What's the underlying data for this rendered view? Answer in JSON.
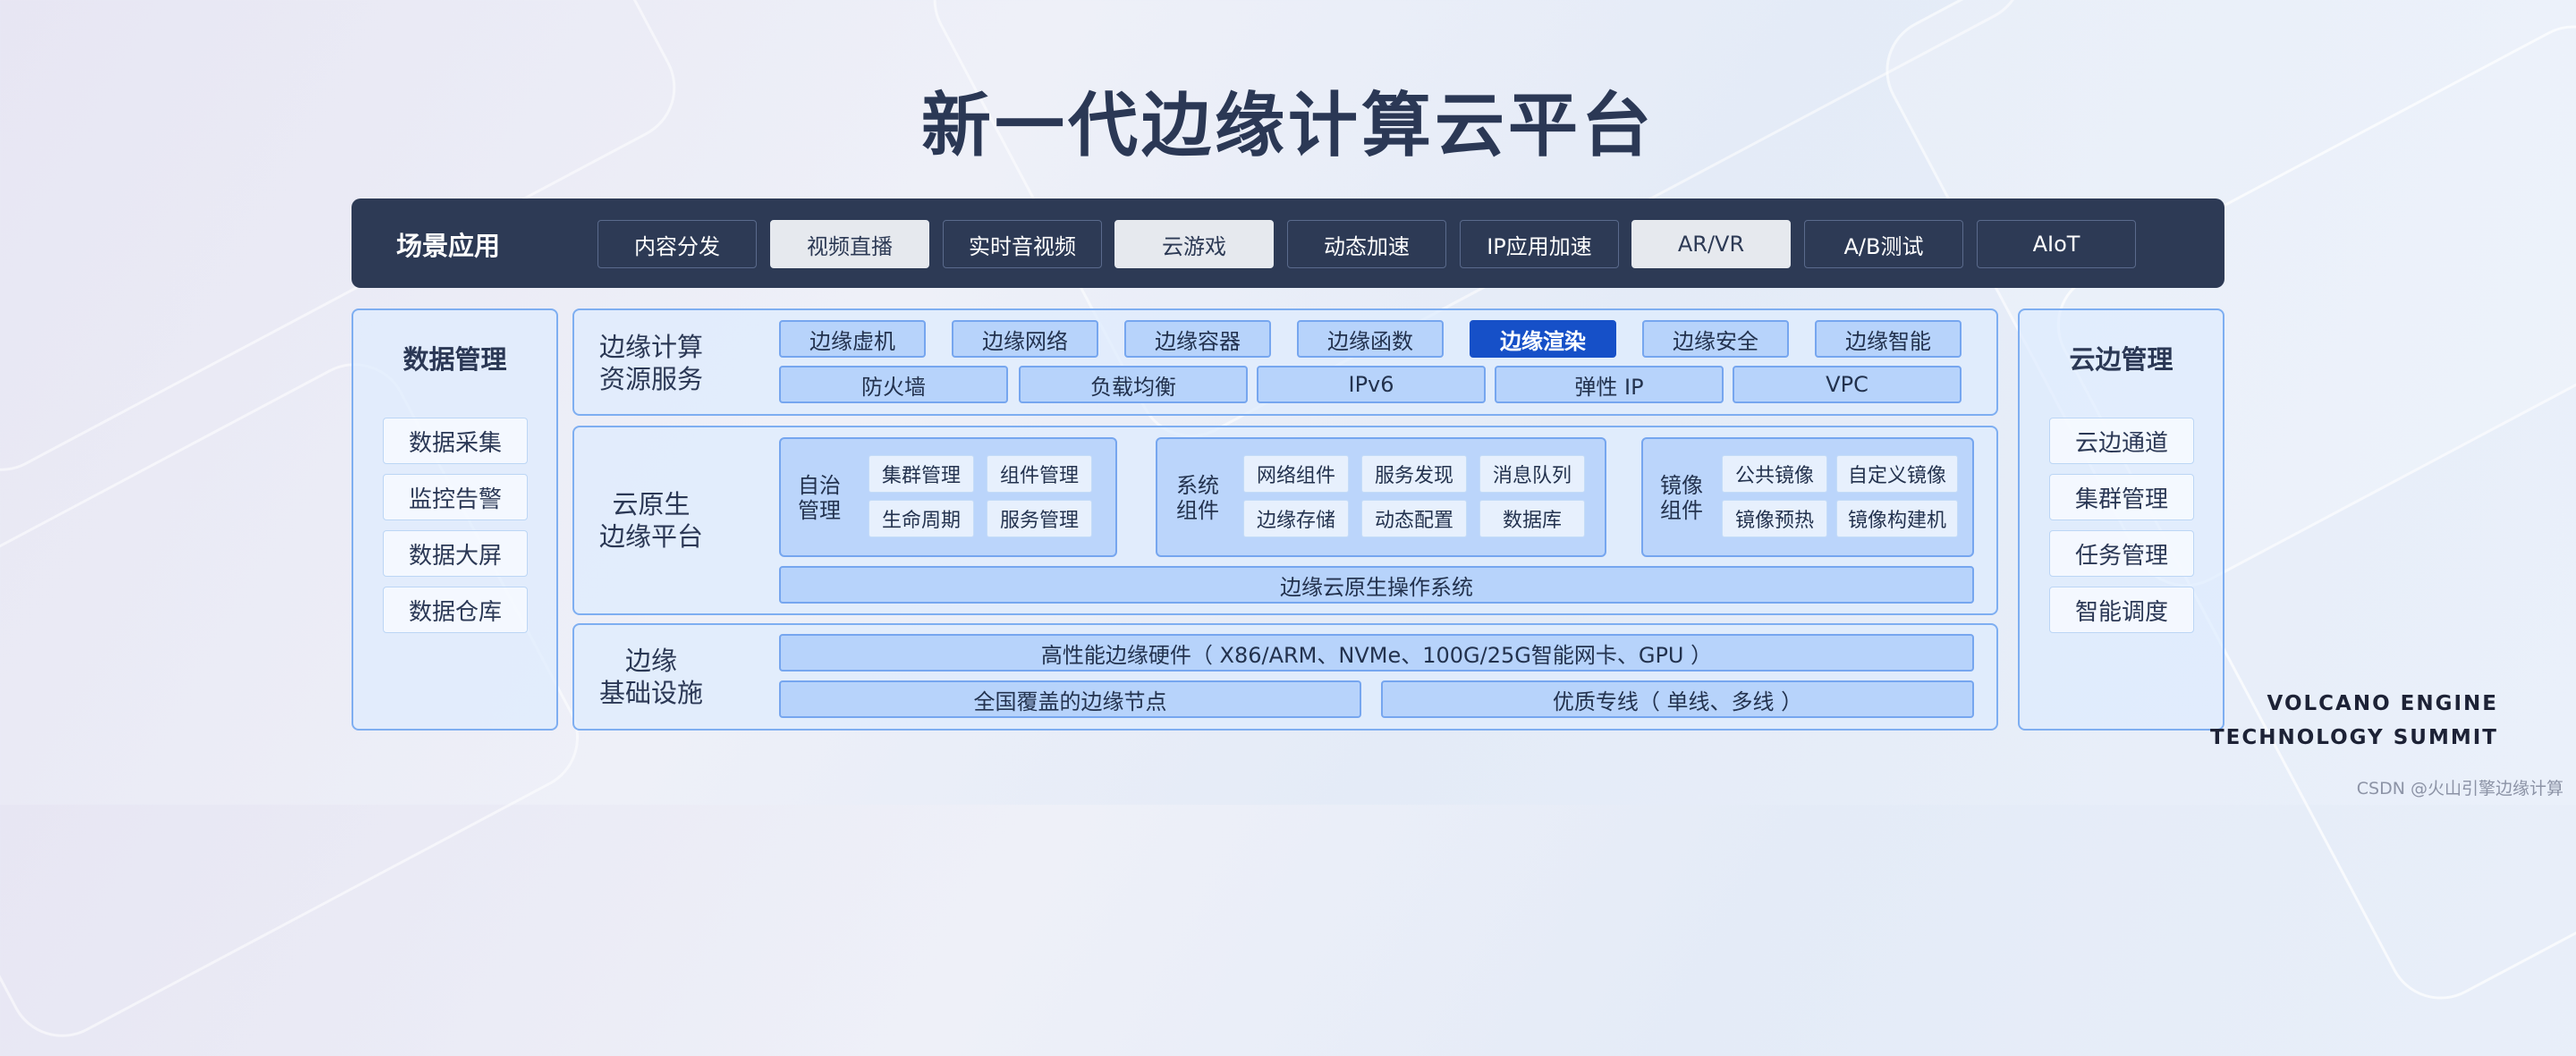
{
  "title": "新一代边缘计算云平台",
  "scenario": {
    "label": "场景应用",
    "items": [
      {
        "label": "内容分发",
        "light": false
      },
      {
        "label": "视频直播",
        "light": true
      },
      {
        "label": "实时音视频",
        "light": false
      },
      {
        "label": "云游戏",
        "light": true
      },
      {
        "label": "动态加速",
        "light": false
      },
      {
        "label": "IP应用加速",
        "light": false
      },
      {
        "label": "AR/VR",
        "light": true
      },
      {
        "label": "A/B测试",
        "light": false
      },
      {
        "label": "AIoT",
        "light": false
      }
    ]
  },
  "left_panel": {
    "title": "数据管理",
    "items": [
      "数据采集",
      "监控告警",
      "数据大屏",
      "数据仓库"
    ]
  },
  "right_panel": {
    "title": "云边管理",
    "items": [
      "云边通道",
      "集群管理",
      "任务管理",
      "智能调度"
    ]
  },
  "compute": {
    "label_line1": "边缘计算",
    "label_line2": "资源服务",
    "row1": [
      "边缘虚机",
      "边缘网络",
      "边缘容器",
      "边缘函数",
      "边缘渲染",
      "边缘安全",
      "边缘智能"
    ],
    "active": "边缘渲染",
    "row2": [
      "防火墙",
      "负载均衡",
      "IPv6",
      "弹性 IP",
      "VPC"
    ]
  },
  "cloud_native": {
    "label_line1": "云原生",
    "label_line2": "边缘平台",
    "groups": [
      {
        "label_line1": "自治",
        "label_line2": "管理",
        "chips": [
          "集群管理",
          "组件管理",
          "生命周期",
          "服务管理"
        ]
      },
      {
        "label_line1": "系统",
        "label_line2": "组件",
        "chips": [
          "网络组件",
          "服务发现",
          "消息队列",
          "边缘存储",
          "动态配置",
          "数据库"
        ]
      },
      {
        "label_line1": "镜像",
        "label_line2": "组件",
        "chips": [
          "公共镜像",
          "自定义镜像",
          "镜像预热",
          "镜像构建机"
        ]
      }
    ],
    "os": "边缘云原生操作系统"
  },
  "infra": {
    "label_line1": "边缘",
    "label_line2": "基础设施",
    "hardware": "高性能边缘硬件（ X86/ARM、NVMe、100G/25G智能网卡、GPU ）",
    "nodes": "全国覆盖的边缘节点",
    "lines": "优质专线（ 单线、多线 ）"
  },
  "brand": {
    "line1": "VOLCANO ENGINE",
    "line2": "TECHNOLOGY SUMMIT"
  },
  "watermark": "CSDN @火山引擎边缘计算",
  "colors": {
    "dark_bar": "#2d3a55",
    "accent": "#1650c8",
    "panel_border": "#7eaef1",
    "box_fill": "#b7d3fb"
  }
}
